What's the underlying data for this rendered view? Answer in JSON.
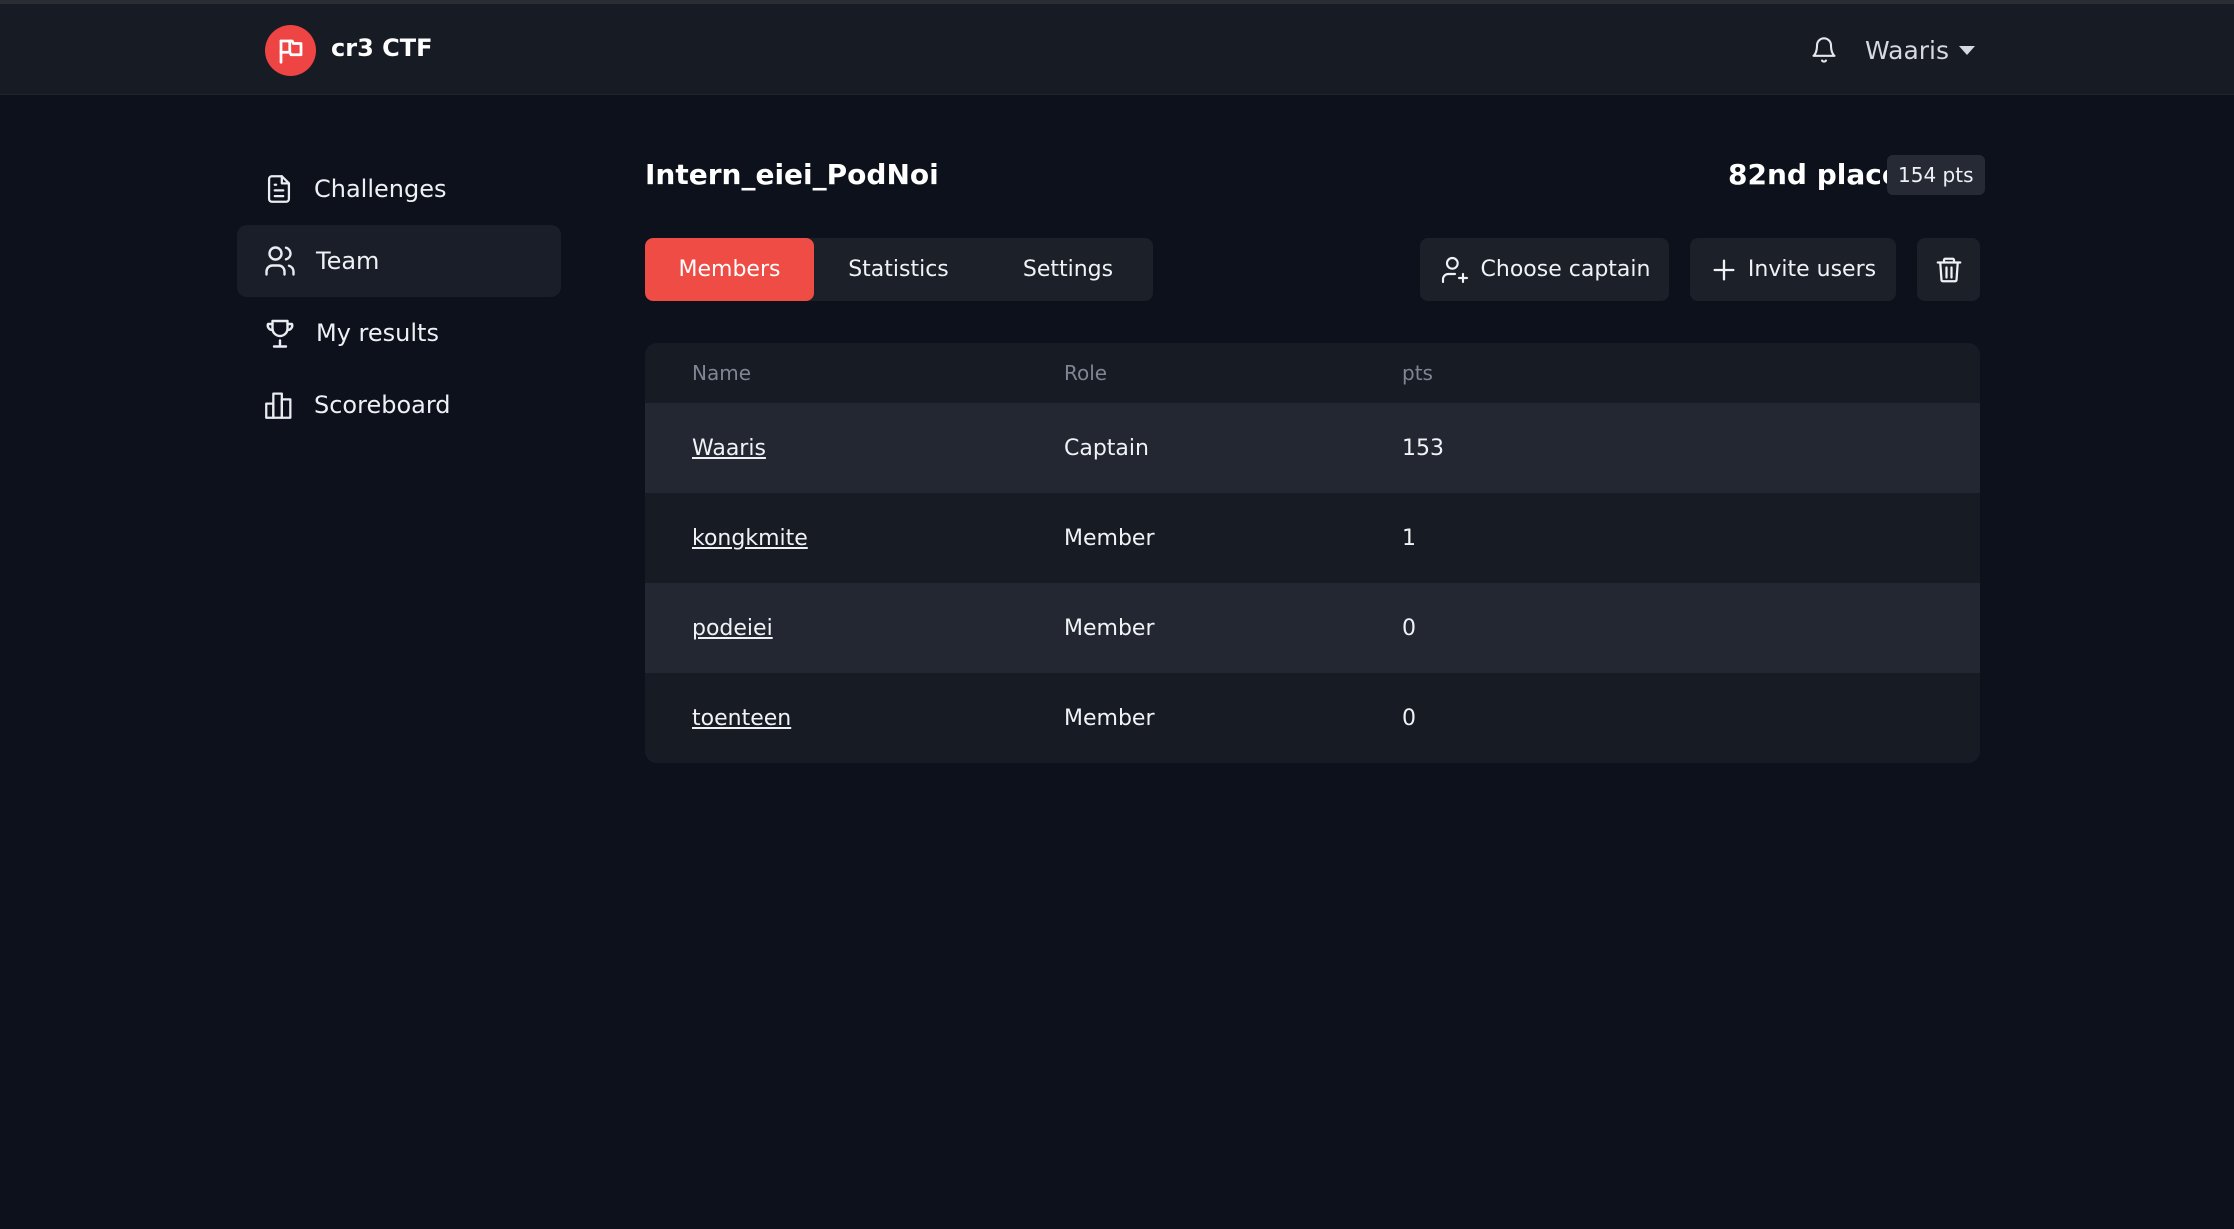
{
  "header": {
    "brand": "cr3 CTF",
    "username": "Waaris"
  },
  "sidebar": {
    "items": [
      {
        "label": "Challenges",
        "icon": "document-icon"
      },
      {
        "label": "Team",
        "icon": "users-icon",
        "active": true
      },
      {
        "label": "My results",
        "icon": "trophy-icon"
      },
      {
        "label": "Scoreboard",
        "icon": "bar-chart-icon"
      }
    ]
  },
  "team": {
    "name": "Intern_eiei_PodNoi",
    "place": "82nd place",
    "points": "154 pts"
  },
  "tabs": [
    {
      "label": "Members",
      "active": true
    },
    {
      "label": "Statistics"
    },
    {
      "label": "Settings"
    }
  ],
  "actions": {
    "choose_captain": "Choose captain",
    "invite_users": "Invite users"
  },
  "members_table": {
    "headers": [
      "Name",
      "Role",
      "pts"
    ],
    "rows": [
      {
        "name": "Waaris",
        "role": "Captain",
        "pts": "153"
      },
      {
        "name": "kongkmite",
        "role": "Member",
        "pts": "1"
      },
      {
        "name": "podeiei",
        "role": "Member",
        "pts": "0"
      },
      {
        "name": "toenteen",
        "role": "Member",
        "pts": "0"
      }
    ]
  },
  "colors": {
    "accent": "#ef4c45",
    "background": "#0d111b",
    "surface": "#171b24"
  }
}
